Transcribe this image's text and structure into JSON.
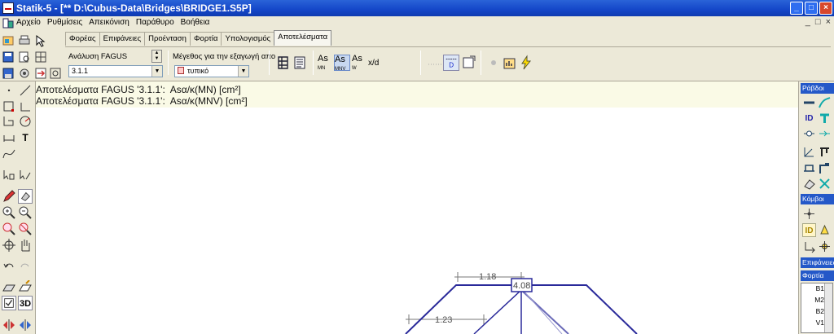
{
  "window": {
    "title": "Statik-5 - [** D:\\Cubus-Data\\Bridges\\BRIDGE1.S5P]",
    "minimize": "_",
    "maximize": "□",
    "close": "×"
  },
  "menu": {
    "items": [
      "Αρχείο",
      "Ρυθμίσεις",
      "Απεικόνιση",
      "Παράθυρο",
      "Βοήθεια"
    ],
    "mdi_controls": [
      "_",
      "□",
      "×"
    ]
  },
  "tabs": [
    "Φορέας",
    "Επιφάνειες",
    "Προένταση",
    "Φορτία",
    "Υπολογισμός",
    "Αποτελέσματα"
  ],
  "active_tab": "Αποτελέσματα",
  "ribbon": {
    "analysis_label": "Ανάλυση FAGUS",
    "analysis_value": "3.1.1",
    "export_size_label": "Μέγεθος για την εξαγωγή απο",
    "export_size_value": "τυπικό",
    "xd_label": "x/d",
    "as_buttons": [
      {
        "main": "As",
        "sub": "MN"
      },
      {
        "main": "As",
        "sub": "MNV"
      },
      {
        "main": "As",
        "sub": "W"
      }
    ],
    "d_label": "D"
  },
  "info_lines": [
    "Αποτελέσματα FAGUS '3.1.1':  Asα/κ(MN) [cm²]",
    "Αποτελέσματα FAGUS '3.1.1':  Asα/κ(MNV) [cm²]"
  ],
  "drawing_labels": {
    "dim_top": "1.18",
    "dim_bottom": "1.23",
    "node_value": "4.08"
  },
  "right_panel": {
    "sections": [
      "Ράβδοι",
      "Κόμβοι",
      "Επιφάνειες",
      "Φορτία"
    ],
    "id_label": "ID",
    "loads": [
      "B1",
      "M2",
      "B2",
      "V1"
    ]
  },
  "left_tools": {
    "text_tool": "T",
    "three_d": "3D"
  },
  "colors": {
    "title_bar": "#1446c8",
    "panel_header": "#2458c8",
    "structure_line": "#2a2a9a",
    "info_background": "#fafae6"
  }
}
